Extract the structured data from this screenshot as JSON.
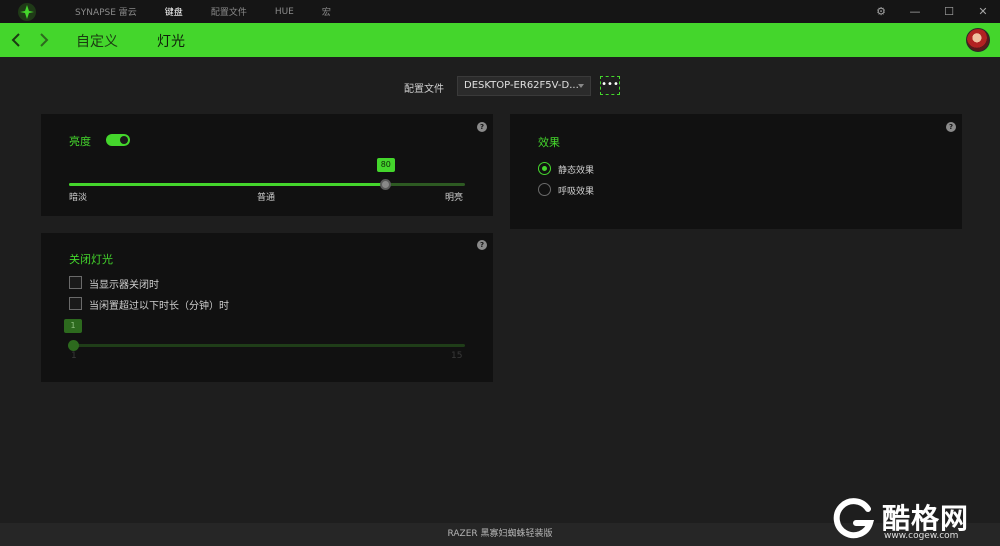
{
  "topnav": {
    "items": [
      {
        "label": "SYNAPSE 雷云",
        "active": false
      },
      {
        "label": "键盘",
        "active": true
      },
      {
        "label": "配置文件",
        "active": false
      },
      {
        "label": "HUE",
        "active": false
      },
      {
        "label": "宏",
        "active": false
      }
    ]
  },
  "window": {
    "settings_icon": "gear-icon",
    "minimize_icon": "minimize-icon",
    "maximize_icon": "maximize-icon",
    "close_icon": "close-icon"
  },
  "subnav": {
    "tabs": [
      {
        "label": "自定义",
        "active": false
      },
      {
        "label": "灯光",
        "active": true
      }
    ]
  },
  "profile": {
    "label": "配置文件",
    "value": "DESKTOP-ER62F5V-D...",
    "more_label": "•••"
  },
  "brightness": {
    "title": "亮度",
    "enabled": true,
    "value": 80,
    "bubble": "80",
    "ticks": [
      "暗淡",
      "普通",
      "明亮"
    ],
    "help": "?"
  },
  "effects": {
    "title": "效果",
    "help": "?",
    "options": [
      {
        "label": "静态效果",
        "checked": true
      },
      {
        "label": "呼吸效果",
        "checked": false
      }
    ]
  },
  "lights_off": {
    "title": "关闭灯光",
    "help": "?",
    "checkboxes": [
      {
        "label": "当显示器关闭时",
        "checked": false
      },
      {
        "label": "当闲置超过以下时长（分钟）时",
        "checked": false
      }
    ],
    "slider_bubble": "1",
    "slider_min": "1",
    "slider_max": "15",
    "value": 1
  },
  "footer": {
    "device": "RAZER 黑寡妇蜘蛛轻装版"
  },
  "watermark": {
    "brand": "酷格网",
    "url": "www.cogew.com"
  },
  "colors": {
    "accent": "#44d62c",
    "panel": "#111111",
    "background": "#1e1e1e"
  }
}
